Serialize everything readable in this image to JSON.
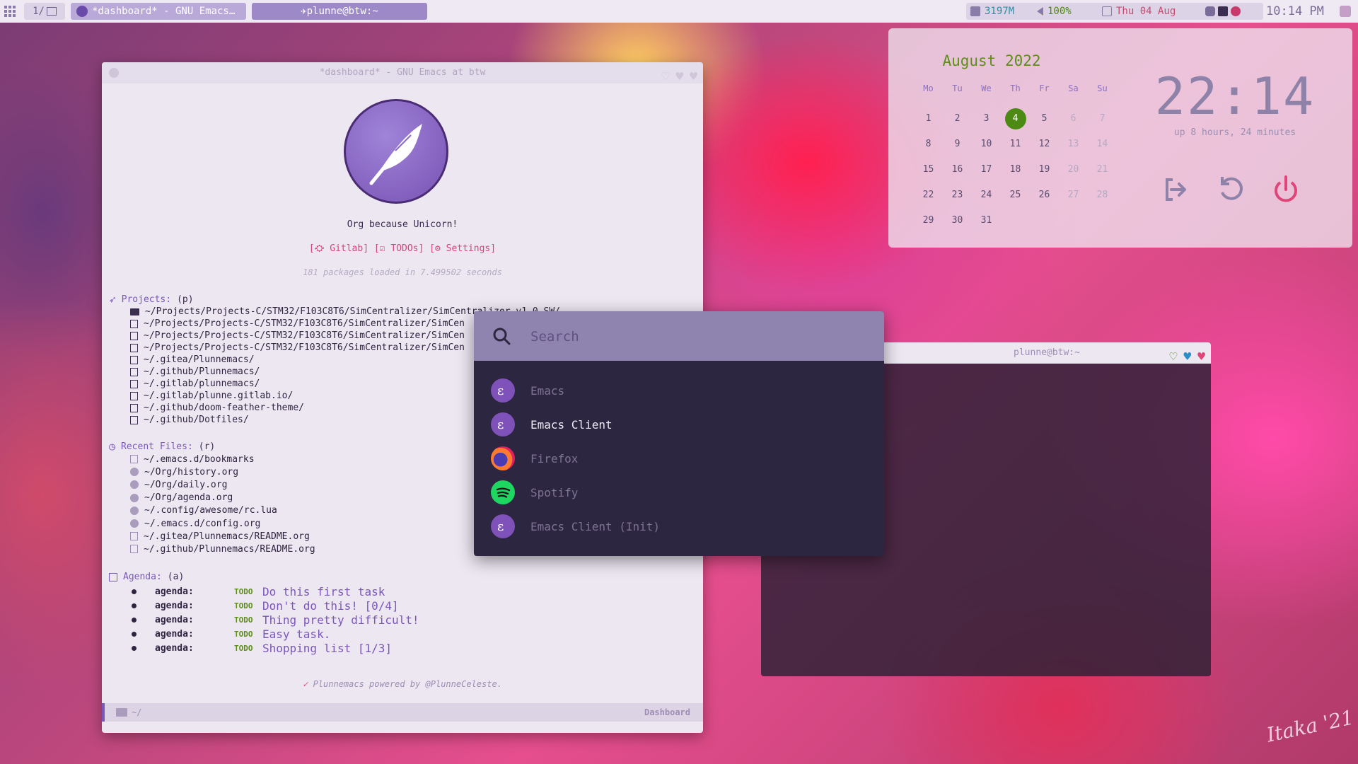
{
  "topbar": {
    "tag": "1/",
    "task_emacs": "*dashboard* - GNU Emacs…",
    "task_term": "✈plunne@btw:~",
    "memory": "3197M",
    "volume": "100%",
    "date": "Thu 04 Aug",
    "clock": "10:14 PM"
  },
  "emacs": {
    "title": "*dashboard* - GNU Emacs at btw",
    "tagline": "Org because Unicorn!",
    "links": [
      "[⛮ Gitlab]",
      "[☑ TODOs]",
      "[⚙ Settings]"
    ],
    "packages": "181 packages loaded in 7.499502 seconds",
    "projects_label": "Projects:",
    "projects_key": "(p)",
    "projects": [
      "~/Projects/Projects-C/STM32/F103C8T6/SimCentralizer/SimCentralizer_v1.0_SW/",
      "~/Projects/Projects-C/STM32/F103C8T6/SimCentralizer/SimCen",
      "~/Projects/Projects-C/STM32/F103C8T6/SimCentralizer/SimCen",
      "~/Projects/Projects-C/STM32/F103C8T6/SimCentralizer/SimCen",
      "~/.gitea/Plunnemacs/",
      "~/.github/Plunnemacs/",
      "~/.gitlab/plunnemacs/",
      "~/.gitlab/plunne.gitlab.io/",
      "~/.github/doom-feather-theme/",
      "~/.github/Dotfiles/"
    ],
    "recent_label": "Recent Files:",
    "recent_key": "(r)",
    "recent": [
      "~/.emacs.d/bookmarks",
      "~/Org/history.org",
      "~/Org/daily.org",
      "~/Org/agenda.org",
      "~/.config/awesome/rc.lua",
      "~/.emacs.d/config.org",
      "~/.gitea/Plunnemacs/README.org",
      "~/.github/Plunnemacs/README.org"
    ],
    "agenda_label": "Agenda:",
    "agenda_key": "(a)",
    "agenda": [
      {
        "key": "agenda:",
        "state": "TODO",
        "text": "Do this first task"
      },
      {
        "key": "agenda:",
        "state": "TODO",
        "text": "Don't do this! [0/4]"
      },
      {
        "key": "agenda:",
        "state": "TODO",
        "text": "Thing pretty difficult!"
      },
      {
        "key": "agenda:",
        "state": "TODO",
        "text": "Easy task."
      },
      {
        "key": "agenda:",
        "state": "TODO",
        "text": "Shopping list [1/3]"
      }
    ],
    "powered": "Plunnemacs powered by @PlunneCeleste.",
    "modeline_dir": "~/",
    "modeline_mode": "Dashboard"
  },
  "calendar": {
    "title": "August 2022",
    "weekdays": [
      "Mo",
      "Tu",
      "We",
      "Th",
      "Fr",
      "Sa",
      "Su"
    ],
    "days": [
      "1",
      "2",
      "3",
      "4",
      "5",
      "6",
      "7",
      "8",
      "9",
      "10",
      "11",
      "12",
      "13",
      "14",
      "15",
      "16",
      "17",
      "18",
      "19",
      "20",
      "21",
      "22",
      "23",
      "24",
      "25",
      "26",
      "27",
      "28",
      "29",
      "30",
      "31"
    ],
    "today": "4",
    "clock": "22:14",
    "uptime": "up 8 hours, 24 minutes",
    "colors": {
      "today": "#4c8a14",
      "logout": "#8e82a8",
      "reboot": "#8e82a8",
      "power": "#e0457a"
    }
  },
  "terminal": {
    "title": "plunne@btw:~"
  },
  "launcher": {
    "placeholder": "Search",
    "items": [
      {
        "label": "Emacs",
        "icon": "emacs-icon"
      },
      {
        "label": "Emacs Client",
        "icon": "emacs-icon"
      },
      {
        "label": "Firefox",
        "icon": "firefox-icon"
      },
      {
        "label": "Spotify",
        "icon": "spotify-icon"
      },
      {
        "label": "Emacs Client (Init)",
        "icon": "emacs-icon"
      }
    ],
    "selected": "Emacs Client"
  },
  "wallpaper": {
    "signature": "Itaka '21"
  }
}
